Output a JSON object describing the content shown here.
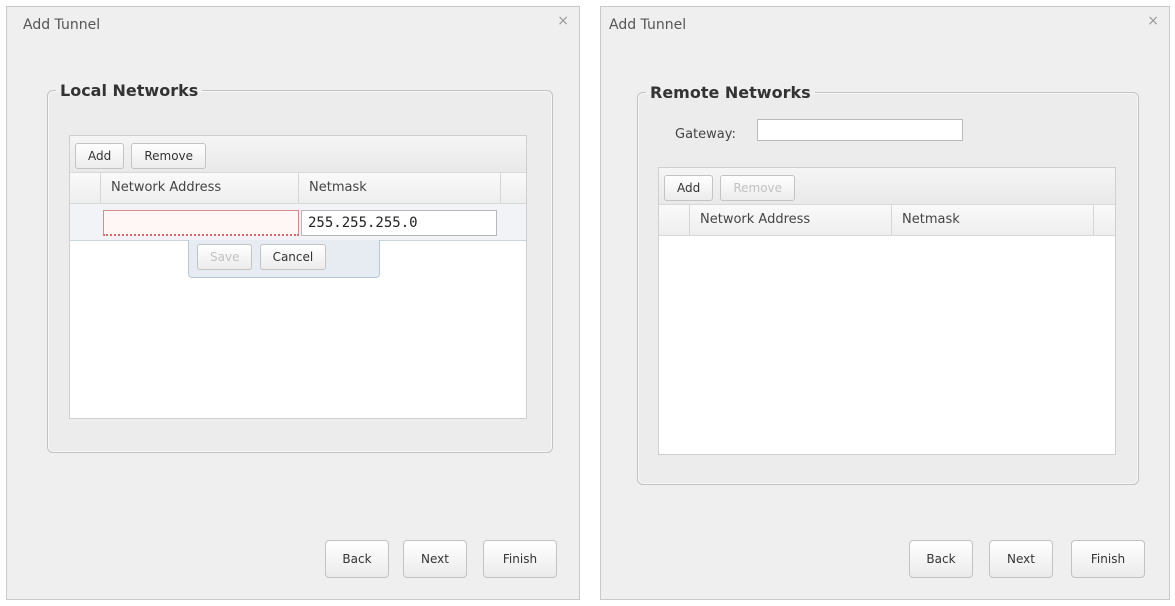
{
  "left_dialog": {
    "title": "Add Tunnel",
    "close_glyph": "×",
    "section_title": "Local Networks",
    "toolbar": {
      "add_label": "Add",
      "remove_label": "Remove"
    },
    "columns": [
      "Network Address",
      "Netmask"
    ],
    "editing_row": {
      "network_address": "",
      "netmask": "255.255.255.0"
    },
    "row_editor": {
      "save_label": "Save",
      "cancel_label": "Cancel"
    },
    "footer": {
      "back_label": "Back",
      "next_label": "Next",
      "finish_label": "Finish"
    }
  },
  "right_dialog": {
    "title": "Add Tunnel",
    "close_glyph": "×",
    "section_title": "Remote Networks",
    "gateway": {
      "label": "Gateway:",
      "value": ""
    },
    "toolbar": {
      "add_label": "Add",
      "remove_label": "Remove"
    },
    "columns": [
      "Network Address",
      "Netmask"
    ],
    "footer": {
      "back_label": "Back",
      "next_label": "Next",
      "finish_label": "Finish"
    }
  },
  "colors": {
    "dialog_bg": "#efefef",
    "invalid_field_border": "#d46a6a",
    "row_editor_bg": "#e7ecf2"
  }
}
